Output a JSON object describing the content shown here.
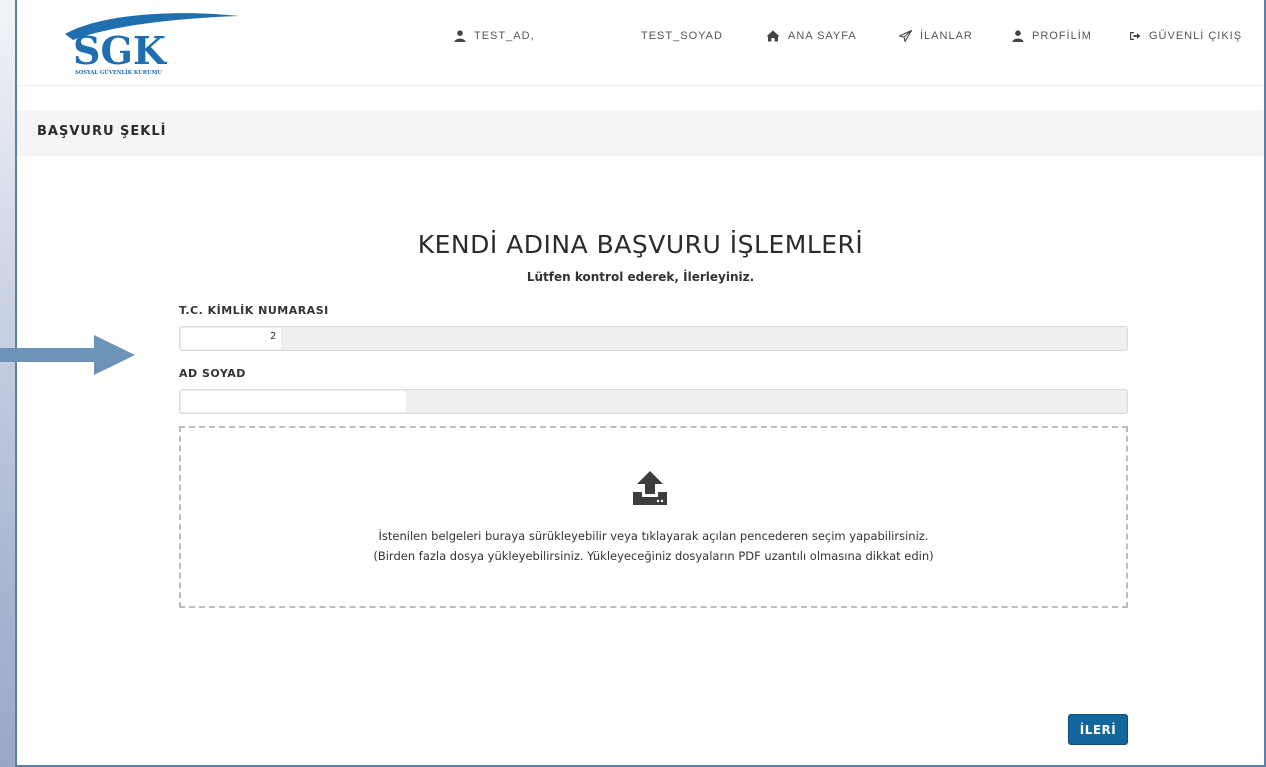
{
  "header": {
    "logo": {
      "text": "SGK",
      "subtext": "SOSYAL GÜVENLİK KURUMU"
    },
    "user": {
      "first": "TEST_AD,",
      "last": "TEST_SOYAD",
      "icon": "user-icon"
    },
    "nav": [
      {
        "label": "ANA SAYFA",
        "icon": "home-icon"
      },
      {
        "label": "İLANLAR",
        "icon": "paper-plane-icon"
      },
      {
        "label": "PROFİLİM",
        "icon": "user-icon"
      },
      {
        "label": "GÜVENLİ ÇIKIŞ",
        "icon": "sign-out-icon"
      }
    ]
  },
  "section": {
    "title": "BAŞVURU ŞEKLİ"
  },
  "main": {
    "title": "KENDİ ADINA BAŞVURU İŞLEMLERİ",
    "subtitle": "Lütfen kontrol ederek, İlerleyiniz.",
    "tc_label": "T.C. KİMLİK NUMARASI",
    "tc_value": "2",
    "name_label": "AD SOYAD",
    "name_value": ""
  },
  "dropzone": {
    "icon": "upload-icon",
    "line1": "İstenilen belgeleri buraya sürükleyebilir veya tıklayarak açılan pencederen seçim yapabilirsiniz.",
    "line2": "(Birden fazla dosya yükleyebilirsiniz. Yükleyeceğiniz dosyaların PDF uzantılı olmasına dikkat edin)"
  },
  "buttons": {
    "next": "İLERİ"
  },
  "colors": {
    "brand": "#1f6fb0",
    "button": "#13679d",
    "arrow": "#6e93b8",
    "frame_border": "#5b7fa8"
  }
}
